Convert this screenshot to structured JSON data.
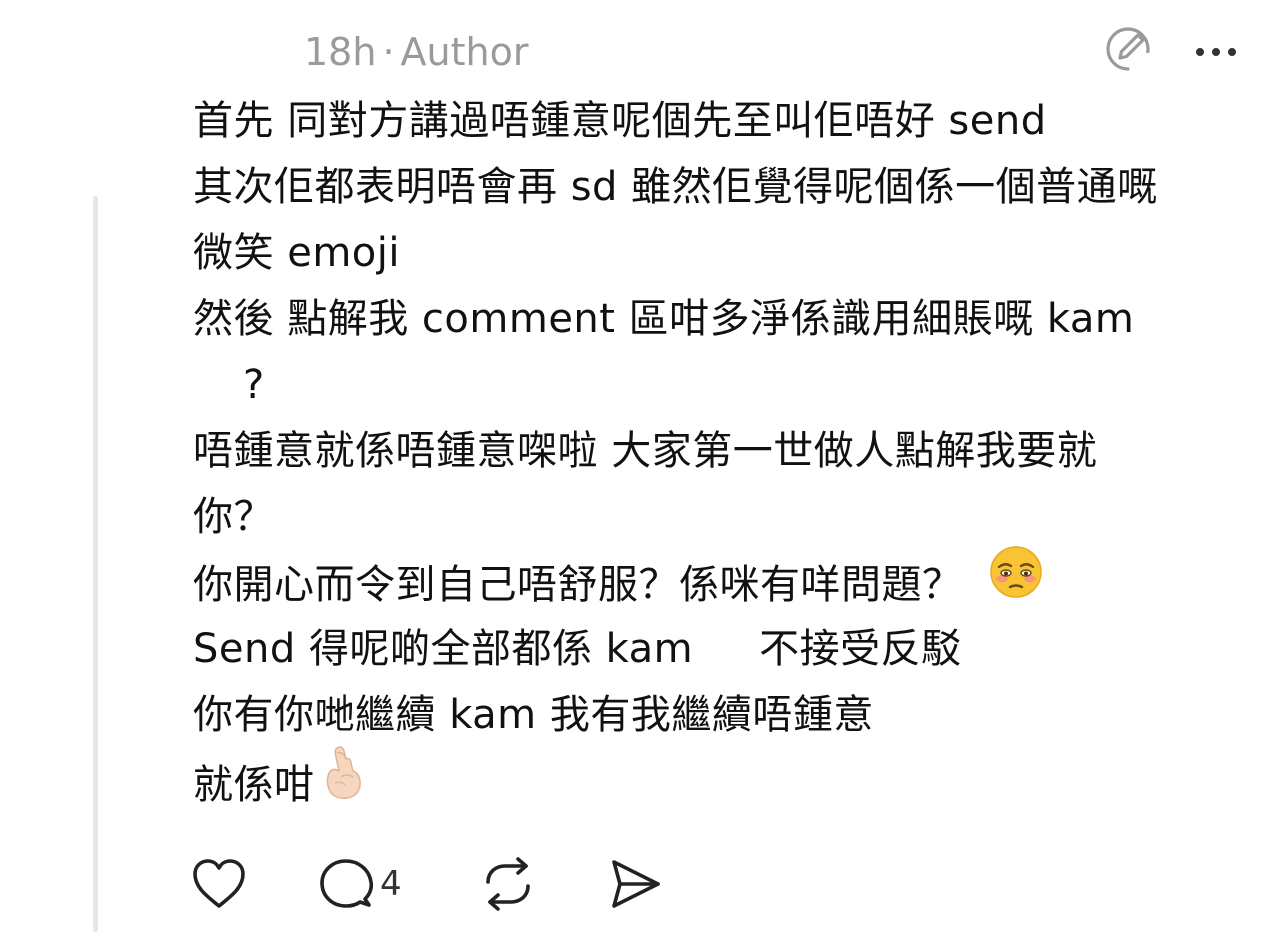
{
  "post": {
    "timestamp": "18h",
    "separator": "·",
    "author_tag": "Author",
    "lines": [
      "首先 同對方講過唔鍾意呢個先至叫佢唔好 send",
      "其次佢都表明唔會再 sd 雖然佢覺得呢個係一個普通嘅",
      "微笑 emoji",
      "然後 點解我 comment 區咁多淨係識用細賬嘅 kam",
      "?",
      "唔鍾意就係唔鍾意㗎啦 大家第一世做人點解我要就",
      "你？",
      "你開心而令到自己唔舒服？係咪有咩問題？",
      "Send 得呢啲全部都係 kam     不接受反駁",
      "你有你哋繼續 kam 我有我繼續唔鍾意",
      "就係咁"
    ]
  },
  "actions": {
    "like_icon": "heart-icon",
    "reply_icon": "comment-bubble-icon",
    "reply_count": "4",
    "repost_icon": "repost-icon",
    "share_icon": "send-icon"
  },
  "header": {
    "edit_icon": "edit-pencil-icon",
    "more_icon": "more-dots-icon"
  },
  "colors": {
    "text": "#111111",
    "meta": "#9a9a9a",
    "thread_line": "#e6e6e6"
  }
}
